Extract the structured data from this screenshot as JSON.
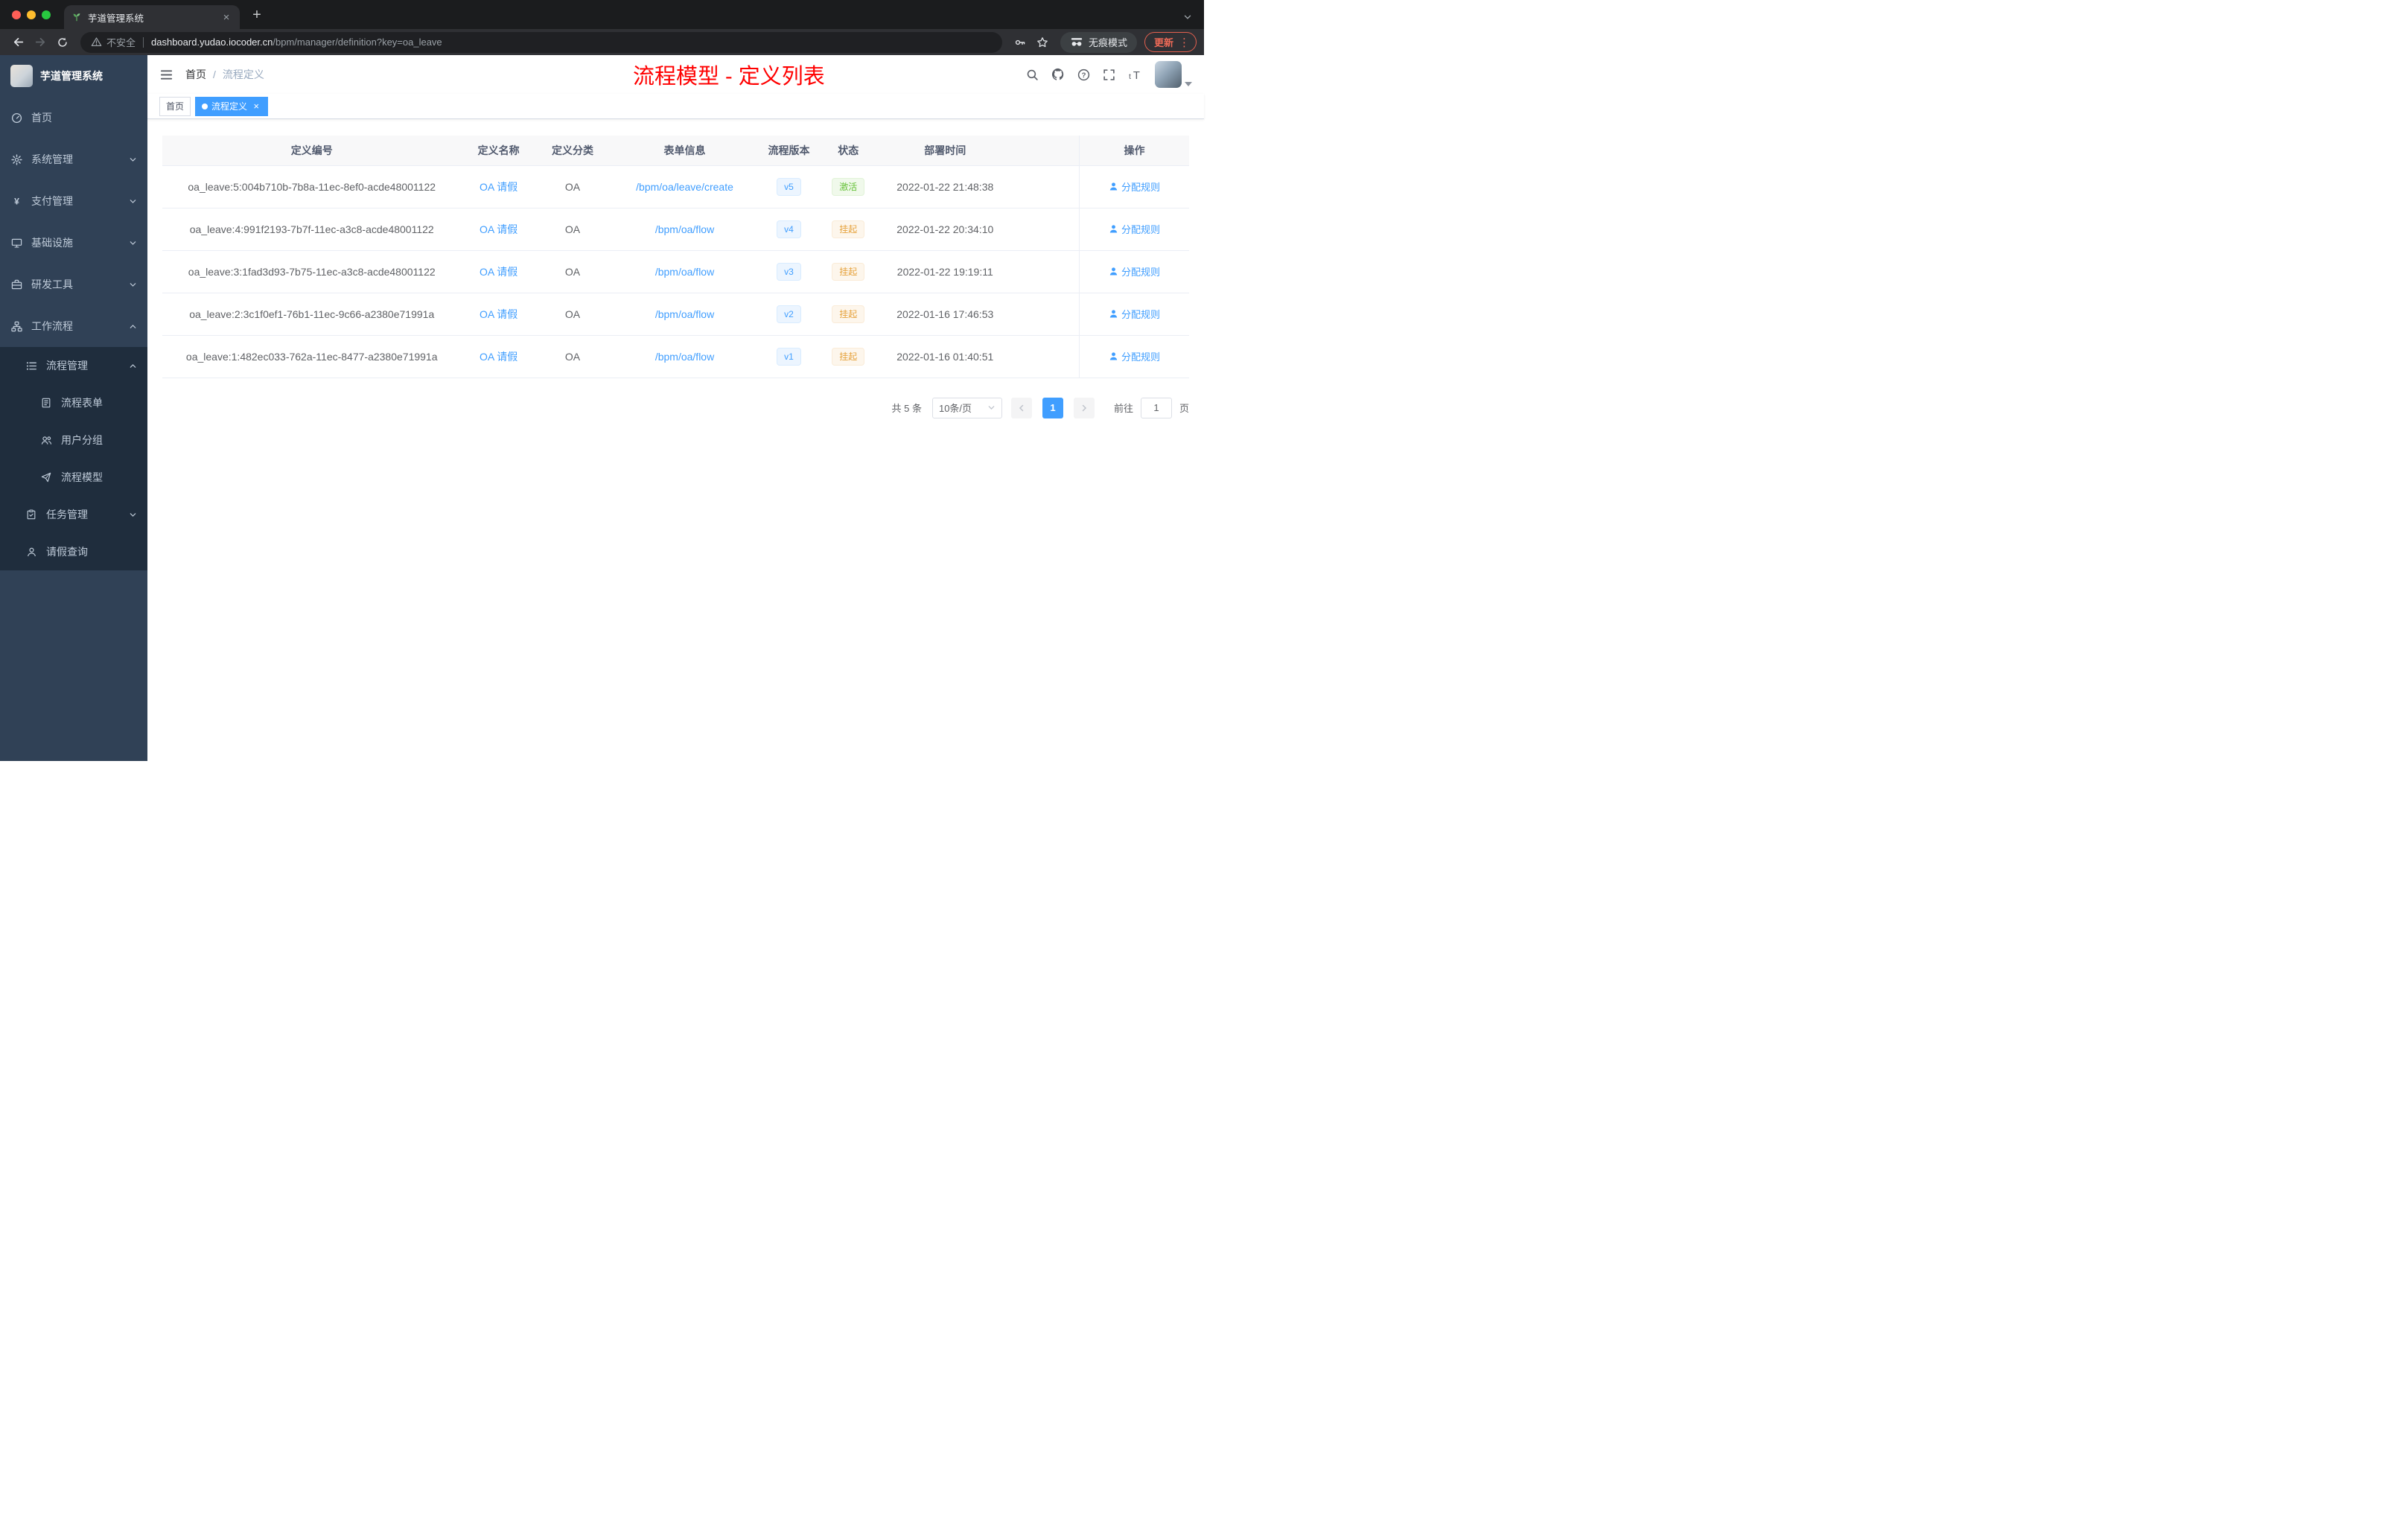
{
  "colors": {
    "accent_blue": "#409eff",
    "success_green": "#67c23a",
    "warning_orange": "#e6a23c",
    "overlay_red": "#ff0000",
    "sidebar_bg": "#304156",
    "submenu_bg": "#1f2d3d",
    "active_tag_bg": "#409eff"
  },
  "browser": {
    "tab": {
      "title": "芋道管理系统"
    },
    "address": {
      "security_label": "不安全",
      "host": "dashboard.yudao.iocoder.cn",
      "path": "/bpm/manager/definition?key=oa_leave"
    },
    "incognito_label": "无痕模式",
    "update_label": "更新"
  },
  "sidebar": {
    "logo_title": "芋道管理系统",
    "items": [
      {
        "label": "首页",
        "icon": "home-icon",
        "level": 1,
        "arrow": "none"
      },
      {
        "label": "系统管理",
        "icon": "gear-icon",
        "level": 1,
        "arrow": "down"
      },
      {
        "label": "支付管理",
        "icon": "yen-icon",
        "level": 1,
        "arrow": "down"
      },
      {
        "label": "基础设施",
        "icon": "infrastructure-icon",
        "level": 1,
        "arrow": "down"
      },
      {
        "label": "研发工具",
        "icon": "devtools-icon",
        "level": 1,
        "arrow": "down"
      },
      {
        "label": "工作流程",
        "icon": "workflow-icon",
        "level": 1,
        "arrow": "up"
      },
      {
        "label": "流程管理",
        "icon": "process-list-icon",
        "level": 2,
        "arrow": "up"
      },
      {
        "label": "流程表单",
        "icon": "form-icon",
        "level": 3,
        "arrow": "none"
      },
      {
        "label": "用户分组",
        "icon": "user-group-icon",
        "level": 3,
        "arrow": "none"
      },
      {
        "label": "流程模型",
        "icon": "model-icon",
        "level": 3,
        "arrow": "none"
      },
      {
        "label": "任务管理",
        "icon": "task-icon",
        "level": 2,
        "arrow": "down"
      },
      {
        "label": "请假查询",
        "icon": "person-icon",
        "level": 2,
        "arrow": "none"
      }
    ]
  },
  "header": {
    "breadcrumb": {
      "items": [
        "首页",
        "流程定义"
      ],
      "separator": "/"
    },
    "overlay_title": "流程模型 - 定义列表"
  },
  "tags": [
    {
      "label": "首页",
      "active": false,
      "closable": false
    },
    {
      "label": "流程定义",
      "active": true,
      "closable": true
    }
  ],
  "table": {
    "columns": [
      "定义编号",
      "定义名称",
      "定义分类",
      "表单信息",
      "流程版本",
      "状态",
      "部署时间",
      "操作"
    ],
    "rows": [
      {
        "id": "oa_leave:5:004b710b-7b8a-11ec-8ef0-acde48001122",
        "name": "OA 请假",
        "category": "OA",
        "form": "/bpm/oa/leave/create",
        "version": "v5",
        "status": "激活",
        "status_type": "success",
        "deploy_time": "2022-01-22 21:48:38",
        "action": "分配规则"
      },
      {
        "id": "oa_leave:4:991f2193-7b7f-11ec-a3c8-acde48001122",
        "name": "OA 请假",
        "category": "OA",
        "form": "/bpm/oa/flow",
        "version": "v4",
        "status": "挂起",
        "status_type": "warning",
        "deploy_time": "2022-01-22 20:34:10",
        "action": "分配规则"
      },
      {
        "id": "oa_leave:3:1fad3d93-7b75-11ec-a3c8-acde48001122",
        "name": "OA 请假",
        "category": "OA",
        "form": "/bpm/oa/flow",
        "version": "v3",
        "status": "挂起",
        "status_type": "warning",
        "deploy_time": "2022-01-22 19:19:11",
        "action": "分配规则"
      },
      {
        "id": "oa_leave:2:3c1f0ef1-76b1-11ec-9c66-a2380e71991a",
        "name": "OA 请假",
        "category": "OA",
        "form": "/bpm/oa/flow",
        "version": "v2",
        "status": "挂起",
        "status_type": "warning",
        "deploy_time": "2022-01-16 17:46:53",
        "action": "分配规则"
      },
      {
        "id": "oa_leave:1:482ec033-762a-11ec-8477-a2380e71991a",
        "name": "OA 请假",
        "category": "OA",
        "form": "/bpm/oa/flow",
        "version": "v1",
        "status": "挂起",
        "status_type": "warning",
        "deploy_time": "2022-01-16 01:40:51",
        "action": "分配规则"
      }
    ]
  },
  "pagination": {
    "total_text": "共 5 条",
    "page_size": "10条/页",
    "current_page": "1",
    "goto_label": "前往",
    "goto_value": "1",
    "page_unit": "页"
  }
}
